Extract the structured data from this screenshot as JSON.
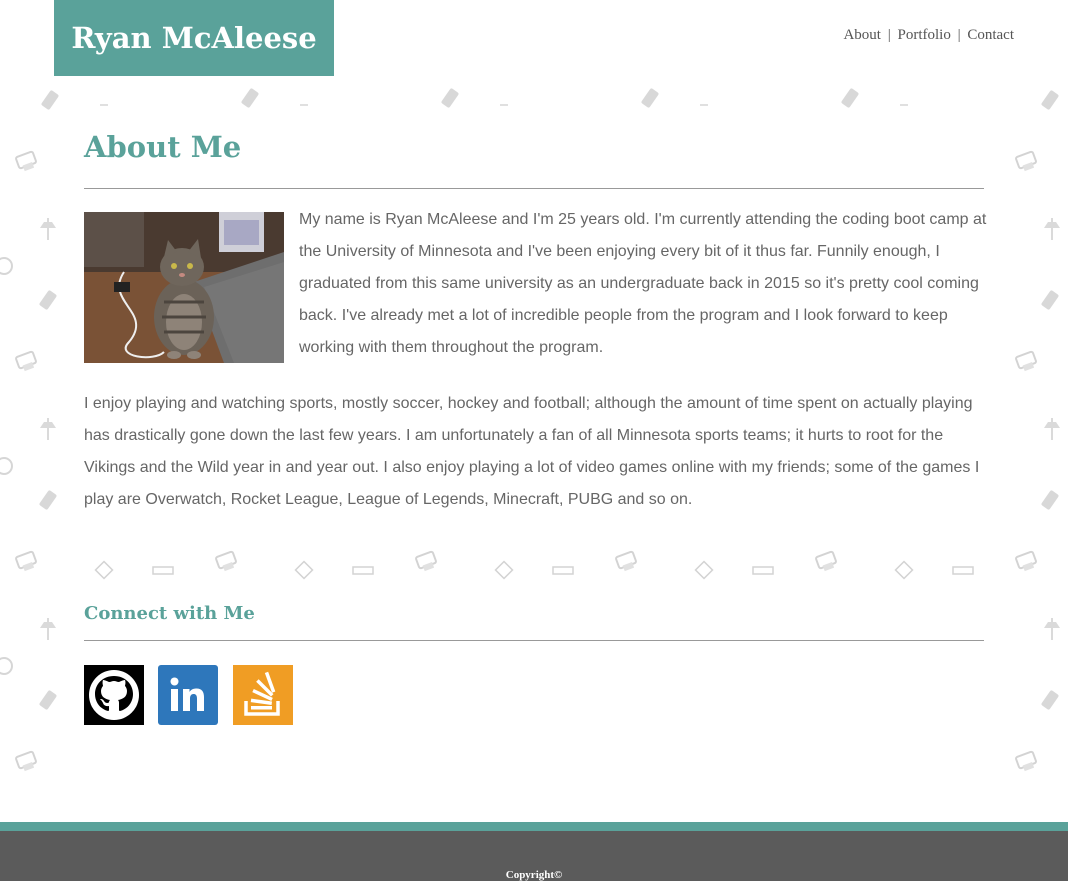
{
  "header": {
    "brand": "Ryan McAleese",
    "nav": [
      {
        "label": "About"
      },
      {
        "label": "Portfolio"
      },
      {
        "label": "Contact"
      }
    ],
    "separator": "|"
  },
  "about": {
    "title": "About Me",
    "photo_icon": "cat-photo",
    "paragraph_1": "My name is Ryan McAleese and I'm 25 years old. I'm currently attending the coding boot camp at the University of Minnesota and I've been enjoying every bit of it thus far. Funnily enough, I graduated from this same university as an undergraduate back in 2015 so it's pretty cool coming back. I've already met a lot of incredible people from the program and I look forward to keep working with them throughout the program.",
    "paragraph_2": "I enjoy playing and watching sports, mostly soccer, hockey and football; although the amount of time spent on actually playing has drastically gone down the last few years. I am unfortunately a fan of all Minnesota sports teams; it hurts to root for the Vikings and the Wild year in and year out. I also enjoy playing a lot of video games online with my friends; some of the games I play are Overwatch, Rocket League, League of Legends, Minecraft, PUBG and so on."
  },
  "connect": {
    "title": "Connect with Me",
    "links": [
      {
        "icon": "github-icon",
        "color": "#000000"
      },
      {
        "icon": "linkedin-icon",
        "color": "#2e77bb"
      },
      {
        "icon": "stackoverflow-icon",
        "color": "#f09d24"
      }
    ]
  },
  "footer": {
    "copyright": "Copyright©"
  },
  "colors": {
    "accent": "#5aa29a",
    "footer_bg": "#5b5b5b",
    "text": "#666666"
  }
}
